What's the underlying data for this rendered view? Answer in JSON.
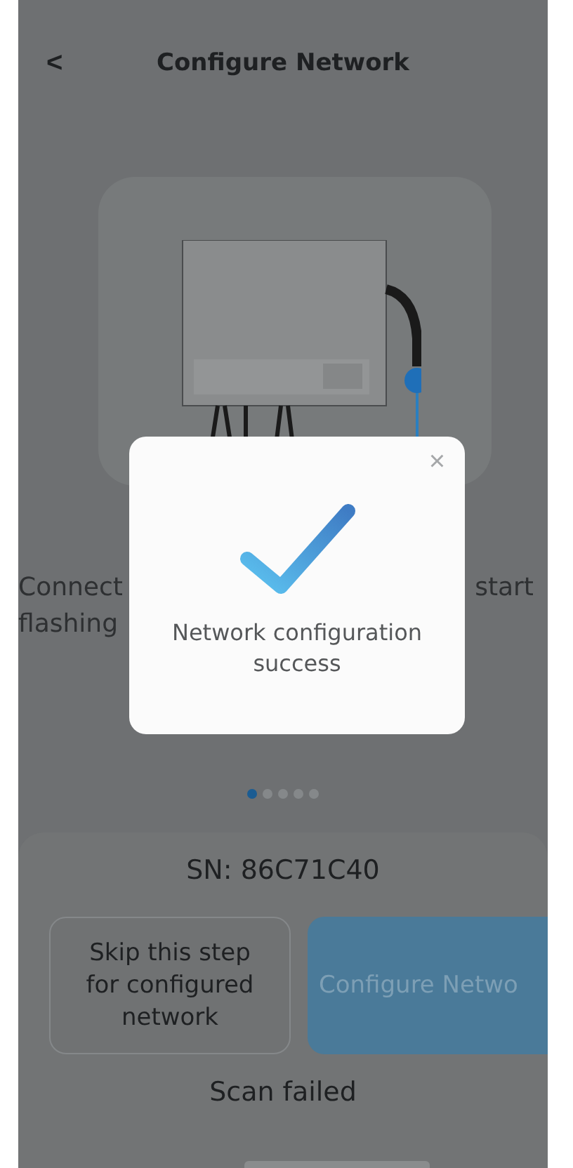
{
  "header": {
    "back": "<",
    "title": "Configure Network"
  },
  "instruction": {
    "line_1_start": "Connect",
    "line_1_end": "start",
    "line_2_start": "flashing"
  },
  "pager": [
    {
      "selected": true
    },
    {
      "selected": false
    },
    {
      "selected": false
    },
    {
      "selected": false
    },
    {
      "selected": false
    }
  ],
  "serial": "SN: 86C71C40",
  "buttons": [
    {
      "kind": "secondary",
      "label": "Skip this step for configured network"
    },
    {
      "kind": "primary",
      "label": "Configure Netwo"
    }
  ],
  "scan_status": "Scan failed",
  "dialog": {
    "close": "×",
    "message": "Network configuration success"
  }
}
